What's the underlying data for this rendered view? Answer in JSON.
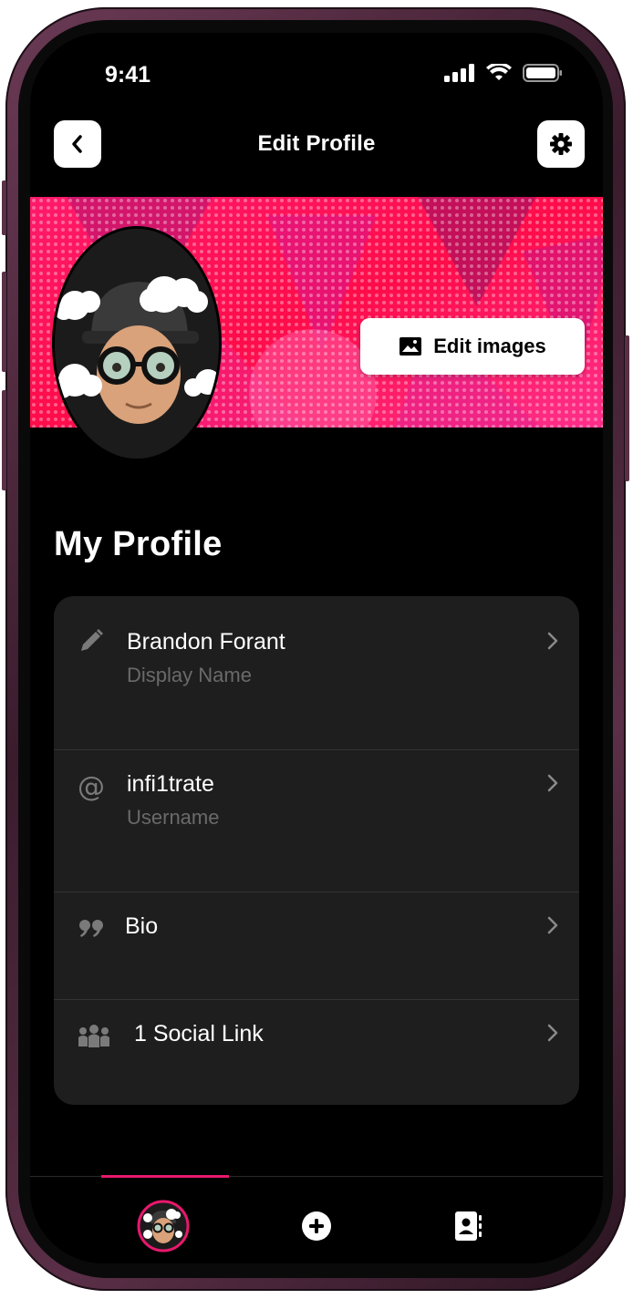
{
  "status_bar": {
    "time": "9:41"
  },
  "header": {
    "title": "Edit Profile"
  },
  "banner": {
    "edit_images_label": "Edit images"
  },
  "profile": {
    "section_title": "My Profile",
    "rows": [
      {
        "value": "Brandon Forant",
        "label": "Display Name",
        "icon": "pencil-icon"
      },
      {
        "value": "infi1trate",
        "label": "Username",
        "icon": "at-sign-icon"
      },
      {
        "value": "Bio",
        "label": "",
        "icon": "quote-icon"
      },
      {
        "value": "1 Social Link",
        "label": "",
        "icon": "people-icon"
      }
    ]
  },
  "tabbar": {
    "tabs": [
      {
        "icon": "avatar-tab-icon",
        "active": true
      },
      {
        "icon": "plus-circle-icon",
        "active": false
      },
      {
        "icon": "contact-card-icon",
        "active": false
      }
    ]
  },
  "colors": {
    "accent": "#e8186d",
    "banner": "#ff1458",
    "card": "#1e1e1e",
    "secondary_text": "#6a6a6a"
  }
}
